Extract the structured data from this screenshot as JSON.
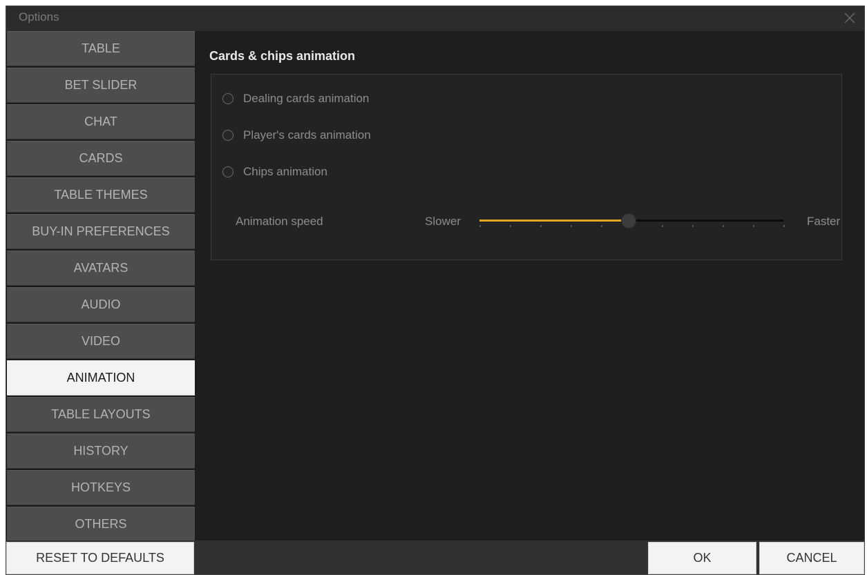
{
  "window": {
    "title": "Options",
    "close_icon": "close-icon"
  },
  "sidebar": {
    "items": [
      {
        "label": "TABLE"
      },
      {
        "label": "BET SLIDER"
      },
      {
        "label": "CHAT"
      },
      {
        "label": "CARDS"
      },
      {
        "label": "TABLE THEMES"
      },
      {
        "label": "BUY-IN PREFERENCES"
      },
      {
        "label": "AVATARS"
      },
      {
        "label": "AUDIO"
      },
      {
        "label": "VIDEO"
      },
      {
        "label": "ANIMATION",
        "active": true
      },
      {
        "label": "TABLE LAYOUTS"
      },
      {
        "label": "HISTORY"
      },
      {
        "label": "HOTKEYS"
      },
      {
        "label": "OTHERS"
      }
    ]
  },
  "content": {
    "section_title": "Cards & chips animation",
    "options": [
      {
        "label": "Dealing cards animation",
        "checked": false
      },
      {
        "label": "Player's cards animation",
        "checked": false
      },
      {
        "label": "Chips animation",
        "checked": false
      }
    ],
    "speed": {
      "label": "Animation speed",
      "min_label": "Slower",
      "max_label": "Faster",
      "value_fraction": 0.49,
      "tick_count": 11,
      "fill_color": "#e3a623"
    }
  },
  "footer": {
    "reset_label": "RESET TO DEFAULTS",
    "ok_label": "OK",
    "cancel_label": "CANCEL"
  }
}
